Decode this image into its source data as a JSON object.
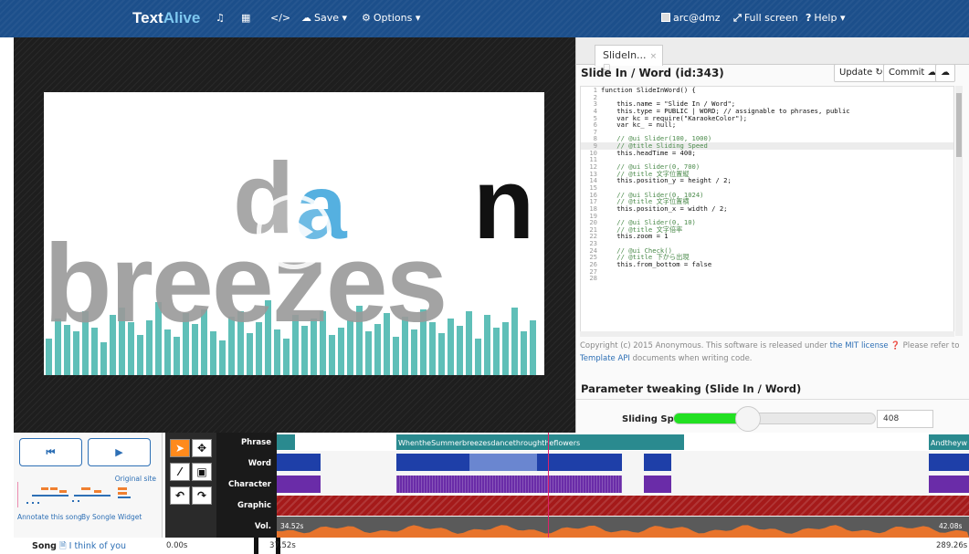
{
  "navbar": {
    "brand_text": "Text",
    "brand_accent": "Alive",
    "save_label": "Save",
    "options_label": "Options",
    "user_label": "arc@dmz",
    "fullscreen_label": "Full screen",
    "help_label": "Help"
  },
  "stage": {
    "words": [
      {
        "text": "d",
        "color": "#a8a8a8"
      },
      {
        "text": "a",
        "color": "#55b0e0"
      },
      {
        "text": "n",
        "color": "#111111"
      },
      {
        "text": "breezes",
        "color": "#9a9a9a"
      }
    ],
    "bar_color": "#5fbfb8"
  },
  "editor": {
    "tab_label": "SlideIn...",
    "title": "Slide In / Word (id:343)",
    "update_label": "Update",
    "commit_label": "Commit",
    "code_lines": [
      {
        "n": "1",
        "t": "function SlideInWord() {"
      },
      {
        "n": "2",
        "t": ""
      },
      {
        "n": "3",
        "t": "    this.name = \"Slide In / Word\";"
      },
      {
        "n": "4",
        "t": "    this.type = PUBLIC | WORD; // assignable to phrases, public"
      },
      {
        "n": "5",
        "t": "    var kc = require(\"KaraokeColor\");"
      },
      {
        "n": "6",
        "t": "    var kc_ = null;"
      },
      {
        "n": "7",
        "t": ""
      },
      {
        "n": "8",
        "t": "    // @ui Slider(100, 1000)"
      },
      {
        "n": "9",
        "t": "    // @title Sliding Speed"
      },
      {
        "n": "10",
        "t": "    this.headTime = 400;"
      },
      {
        "n": "11",
        "t": ""
      },
      {
        "n": "12",
        "t": "    // @ui Slider(0, 700)"
      },
      {
        "n": "13",
        "t": "    // @title 文字位置縦"
      },
      {
        "n": "14",
        "t": "    this.position_y = height / 2;"
      },
      {
        "n": "15",
        "t": ""
      },
      {
        "n": "16",
        "t": "    // @ui Slider(0, 1024)"
      },
      {
        "n": "17",
        "t": "    // @title 文字位置横"
      },
      {
        "n": "18",
        "t": "    this.position_x = width / 2;"
      },
      {
        "n": "19",
        "t": ""
      },
      {
        "n": "20",
        "t": "    // @ui Slider(0, 10)"
      },
      {
        "n": "21",
        "t": "    // @title 文字倍率"
      },
      {
        "n": "22",
        "t": "    this.zoom = 1"
      },
      {
        "n": "23",
        "t": ""
      },
      {
        "n": "24",
        "t": "    // @ui Check()"
      },
      {
        "n": "25",
        "t": "    // @title 下から出現"
      },
      {
        "n": "26",
        "t": "    this.from_bottom = false"
      },
      {
        "n": "27",
        "t": ""
      },
      {
        "n": "28",
        "t": ""
      }
    ],
    "copyright_pre": "Copyright (c) 2015 Anonymous. This software is released under ",
    "copyright_link": "the MIT license",
    "copyright_mid": " Please refer to ",
    "copyright_link2": "Template API",
    "copyright_post": " documents when writing code.",
    "param_header": "Parameter tweaking (Slide In / Word)",
    "param_label": "Sliding Speed",
    "param_value": "408",
    "param_fraction": 0.34
  },
  "player": {
    "prev_label": "⏮",
    "play_label": "▶",
    "original_site": "Original site",
    "annotate": "Annotate this song",
    "by_songle": "By Songle Widget",
    "song_label": "Song",
    "song_title": "I think of you"
  },
  "timeline": {
    "labels": [
      "Phrase",
      "Word",
      "Character",
      "Graphic",
      "Vol."
    ],
    "phrase_text": "WhentheSummerbreezesdancethroughtheflowers",
    "phrase_text2": "Andtheyw",
    "vol_left": "34.52s",
    "vol_right": "42.08s",
    "time_start": "0.00s",
    "time_current": "37.52s",
    "time_end": "289.26s"
  }
}
